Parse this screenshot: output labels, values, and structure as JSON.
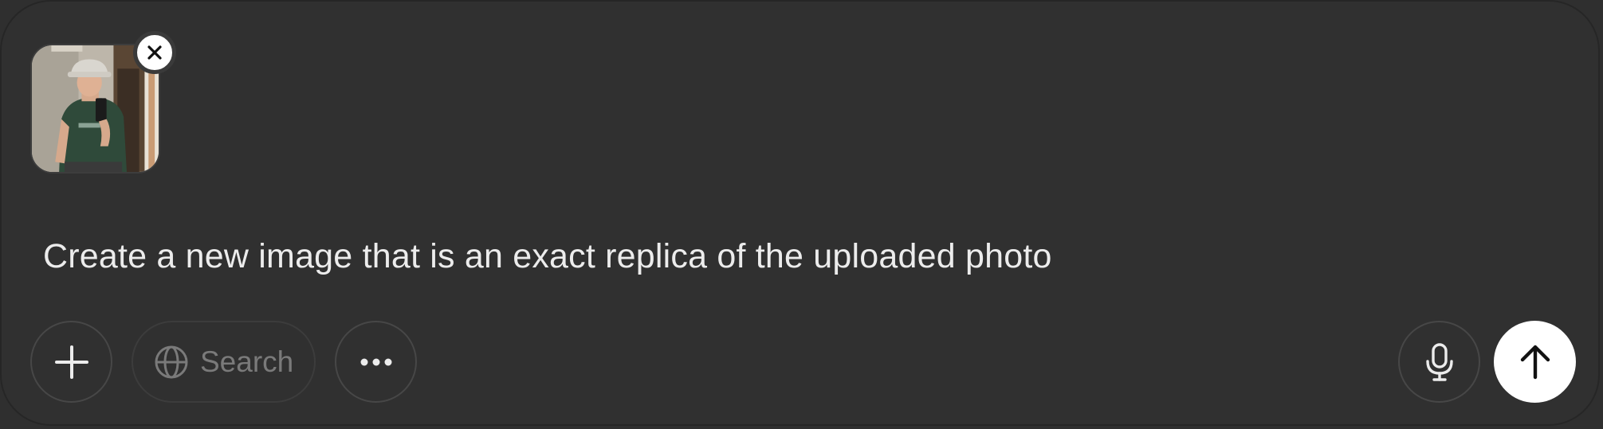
{
  "attachment": {
    "type": "photo",
    "remove_icon": "close-icon"
  },
  "prompt": {
    "text": "Create a new image that is an exact replica of the uploaded photo"
  },
  "toolbar": {
    "add_icon": "plus-icon",
    "search_label": "Search",
    "search_icon": "globe-icon",
    "more_icon": "ellipsis-icon",
    "mic_icon": "microphone-icon",
    "send_icon": "arrow-up-icon"
  },
  "colors": {
    "background": "#303030",
    "text": "#ececec",
    "muted": "#7a7a7a",
    "send_button": "#ffffff"
  }
}
